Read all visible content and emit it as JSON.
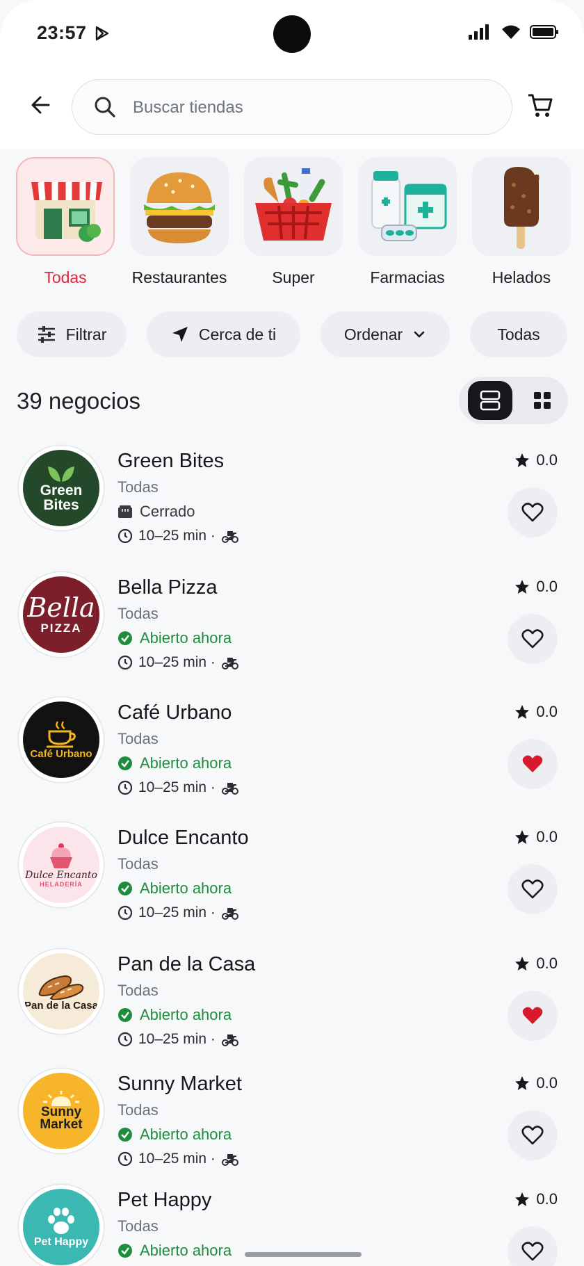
{
  "status_bar": {
    "time": "23:57"
  },
  "search": {
    "placeholder": "Buscar tiendas"
  },
  "categories": [
    {
      "label": "Todas",
      "active": true,
      "icon": "store-icon"
    },
    {
      "label": "Restaurantes",
      "active": false,
      "icon": "burger-icon"
    },
    {
      "label": "Super",
      "active": false,
      "icon": "grocery-basket-icon"
    },
    {
      "label": "Farmacias",
      "active": false,
      "icon": "pharmacy-icon"
    },
    {
      "label": "Helados",
      "active": false,
      "icon": "ice-cream-icon"
    }
  ],
  "filters": {
    "filter": "Filtrar",
    "nearby": "Cerca de ti",
    "sort": "Ordenar",
    "all": "Todas"
  },
  "results": {
    "count_label": "39 negocios"
  },
  "stores": [
    {
      "name": "Green Bites",
      "category": "Todas",
      "status": "Cerrado",
      "open": false,
      "eta": "10–25 min ·",
      "rating": "0.0",
      "favorite": false,
      "logo": {
        "line1": "Green",
        "line2": "Bites"
      }
    },
    {
      "name": "Bella Pizza",
      "category": "Todas",
      "status": "Abierto ahora",
      "open": true,
      "eta": "10–25 min ·",
      "rating": "0.0",
      "favorite": false,
      "logo": {
        "line1": "Bella",
        "line2": "PIZZA"
      }
    },
    {
      "name": "Café Urbano",
      "category": "Todas",
      "status": "Abierto ahora",
      "open": true,
      "eta": "10–25 min ·",
      "rating": "0.0",
      "favorite": true,
      "logo": {
        "line1": "Café Urbano"
      }
    },
    {
      "name": "Dulce Encanto",
      "category": "Todas",
      "status": "Abierto ahora",
      "open": true,
      "eta": "10–25 min ·",
      "rating": "0.0",
      "favorite": false,
      "logo": {
        "line1": "Dulce Encanto",
        "line2": "HELADERÍA"
      }
    },
    {
      "name": "Pan de la Casa",
      "category": "Todas",
      "status": "Abierto ahora",
      "open": true,
      "eta": "10–25 min ·",
      "rating": "0.0",
      "favorite": true,
      "logo": {
        "line1": "Pan de la Casa"
      }
    },
    {
      "name": "Sunny Market",
      "category": "Todas",
      "status": "Abierto ahora",
      "open": true,
      "eta": "10–25 min ·",
      "rating": "0.0",
      "favorite": false,
      "logo": {
        "line1": "Sunny",
        "line2": "Market"
      }
    },
    {
      "name": "Pet Happy",
      "category": "Todas",
      "status": "Abierto ahora",
      "open": true,
      "eta": "",
      "rating": "0.0",
      "favorite": false,
      "logo": {
        "line1": "Pet Happy"
      }
    }
  ],
  "colors": {
    "accent": "#e0283b",
    "open": "#1e8e3e",
    "favorite": "#d7192e",
    "dark": "#16171b"
  }
}
